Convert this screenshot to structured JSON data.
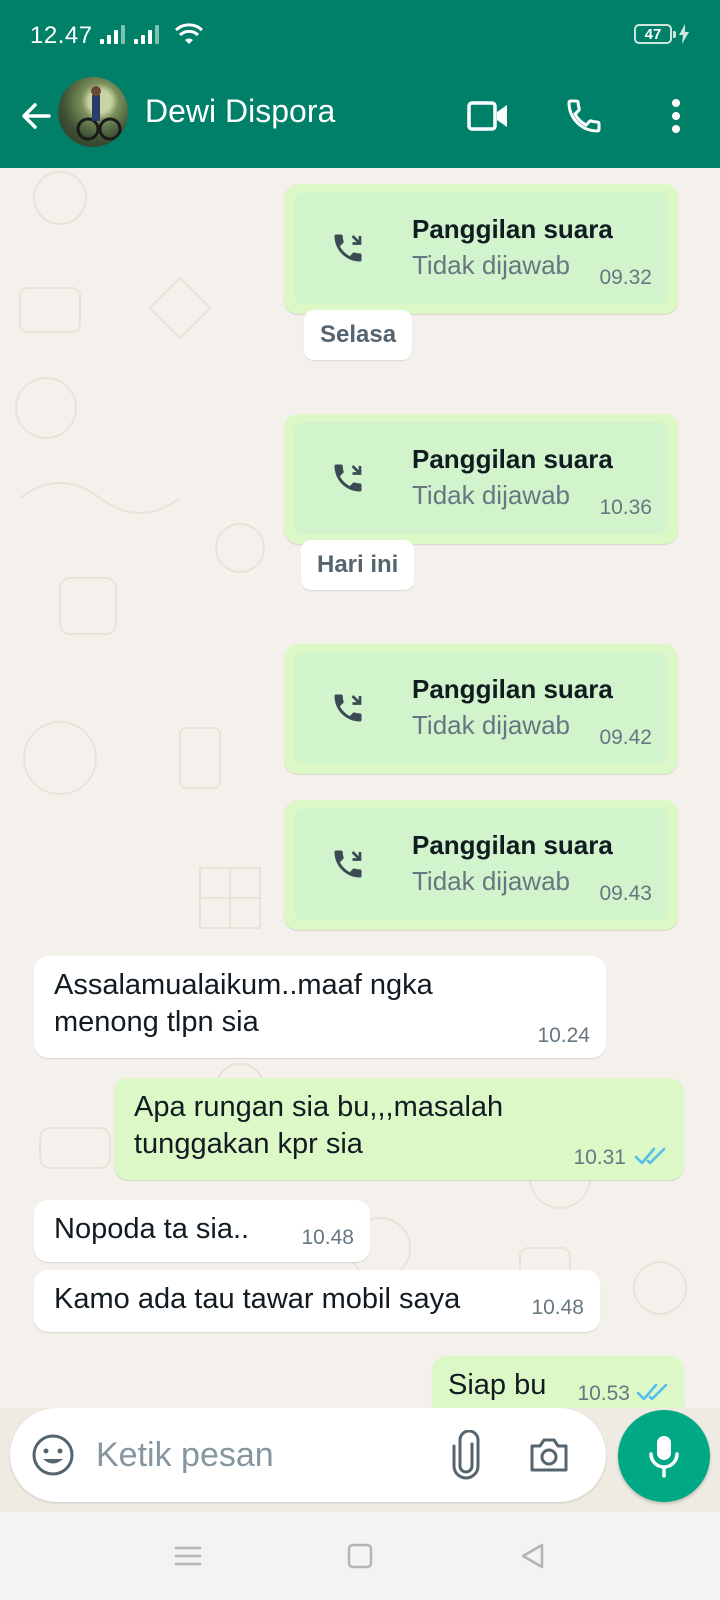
{
  "status_bar": {
    "time": "12.47",
    "battery": "47"
  },
  "header": {
    "contact_name": "Dewi Dispora"
  },
  "messages": {
    "call1": {
      "title": "Panggilan suara",
      "status": "Tidak dijawab",
      "time": "09.32"
    },
    "date1": "Selasa",
    "call2": {
      "title": "Panggilan suara",
      "status": "Tidak dijawab",
      "time": "10.36"
    },
    "date2": "Hari ini",
    "call3": {
      "title": "Panggilan suara",
      "status": "Tidak dijawab",
      "time": "09.42"
    },
    "call4": {
      "title": "Panggilan suara",
      "status": "Tidak dijawab",
      "time": "09.43"
    },
    "in1": {
      "line1": "Assalamualaikum..maaf ngka",
      "line2": "menong tlpn sia",
      "time": "10.24"
    },
    "out1": {
      "line1": "Apa rungan sia bu,,,masalah",
      "line2": "tunggakan kpr sia",
      "time": "10.31"
    },
    "in2": {
      "text": "Nopoda ta sia..",
      "time": "10.48"
    },
    "in3": {
      "text": "Kamo ada tau tawar mobil saya",
      "time": "10.48"
    },
    "out2": {
      "text": "Siap bu",
      "time": "10.53"
    }
  },
  "composer": {
    "placeholder": "Ketik pesan"
  },
  "colors": {
    "header": "#008069",
    "outgoing_bubble": "#dcf8c6",
    "read_ticks": "#53bdeb",
    "mic_button": "#00a884"
  },
  "icons": [
    "back-arrow-icon",
    "video-call-icon",
    "voice-call-icon",
    "more-options-icon",
    "missed-call-icon",
    "emoji-icon",
    "attach-icon",
    "camera-icon",
    "mic-icon",
    "double-tick-icon"
  ]
}
